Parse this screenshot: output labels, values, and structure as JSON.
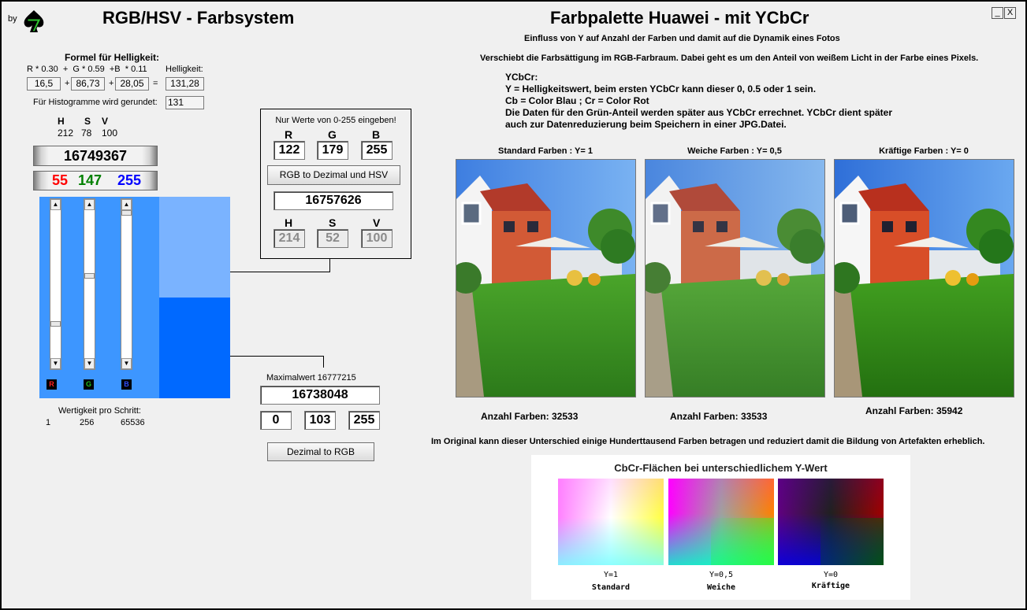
{
  "header": {
    "by_label": "by",
    "left_title": "RGB/HSV - Farbsystem",
    "right_title": "Farbpalette Huawei - mit YCbCr",
    "window_controls": {
      "minimize": "_",
      "close": "X"
    }
  },
  "formula": {
    "heading": "Formel für Helligkeit:",
    "line": "R * 0.30  +  G * 0.59  +B  * 0.11",
    "helligkeit_label": "Helligkeit:",
    "r_value": "16,5",
    "plus1": "+",
    "g_value": "86,73",
    "plus2": "+",
    "b_value": "28,05",
    "equals": "=",
    "result": "131,28",
    "rounded_label": "Für Histogramme wird gerundet:",
    "rounded_value": "131"
  },
  "hsv_readout": {
    "h_label": "H",
    "s_label": "S",
    "v_label": "V",
    "h_value": "212",
    "s_value": "78",
    "v_value": "100"
  },
  "decimal_display": "16749367",
  "rgb_display": {
    "r": "55",
    "g": "147",
    "b": "255"
  },
  "colors": {
    "palette_bg": "#3d96ff",
    "swatch_top": "#7ab3ff",
    "swatch_bottom": "#0069ff",
    "r_text": "#ff0000",
    "g_text": "#008000",
    "b_text": "#0000ff"
  },
  "sliders": {
    "r_label": "R",
    "g_label": "G",
    "b_label": "B",
    "r_level": 0.77,
    "g_level": 0.43,
    "b_level": 0.0
  },
  "wertigkeit": {
    "label": "Wertigkeit pro Schritt:",
    "v1": "1",
    "v2": "256",
    "v3": "65536"
  },
  "converter": {
    "hint": "Nur Werte von 0-255 eingeben!",
    "r_label": "R",
    "g_label": "G",
    "b_label": "B",
    "r_value": "122",
    "g_value": "179",
    "b_value": "255",
    "button": "RGB to Dezimal und HSV",
    "decimal_result": "16757626",
    "h_label": "H",
    "s_label": "S",
    "v_label": "V",
    "h_value": "214",
    "s_value": "52",
    "v_value": "100"
  },
  "dezimal_to_rgb": {
    "max_label": "Maximalwert 16777215",
    "input_value": "16738048",
    "r_value": "0",
    "g_value": "103",
    "b_value": "255",
    "button": "Dezimal to RGB"
  },
  "info": {
    "line1": "Einfluss von Y auf Anzahl der Farben und damit  auf die Dynamik eines Fotos",
    "line2": "Verschiebt die Farbsättigung im RGB-Farbraum. Dabei geht es um den Anteil von weißem Licht in der Farbe eines Pixels.",
    "ycbcr_title": "YCbCr:",
    "ycbcr_line1": "Y = Helligkeitswert, beim ersten YCbCr kann dieser 0, 0.5 oder 1 sein.",
    "ycbcr_line2": "Cb = Color Blau ; Cr = Color Rot",
    "ycbcr_line3": "Die Daten für den Grün-Anteil werden später aus  YCbCr errechnet.  YCbCr dient später",
    "ycbcr_line4": "auch zur Datenreduzierung beim Speichern in einer JPG.Datei."
  },
  "photos": [
    {
      "caption": "Standard Farben : Y= 1",
      "count": "Anzahl Farben: 32533"
    },
    {
      "caption": "Weiche Farben : Y= 0,5",
      "count": "Anzahl Farben: 33533"
    },
    {
      "caption": "Kräftige Farben : Y= 0",
      "count": "Anzahl Farben: 35942"
    }
  ],
  "original_note": "Im Original kann dieser Unterschied einige Hunderttausend Farben betragen und reduziert damit die Bildung von Artefakten erheblich.",
  "cbcr": {
    "title": "CbCr-Flächen bei unterschiedlichem Y-Wert",
    "panels": [
      {
        "y_label": "Y=1",
        "name": "Standard"
      },
      {
        "y_label": "Y=0,5",
        "name": "Weiche"
      },
      {
        "y_label": "Y=0",
        "name": "Kräftige"
      }
    ]
  }
}
